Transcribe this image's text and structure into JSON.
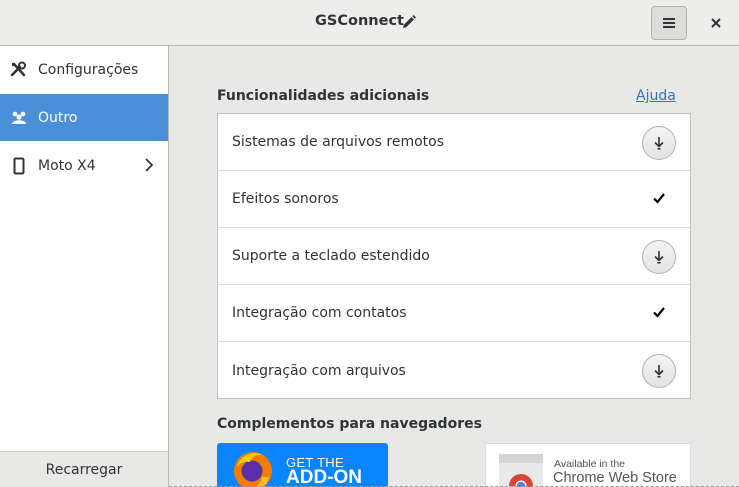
{
  "window": {
    "title": "GSConnect"
  },
  "sidebar": {
    "items": [
      {
        "label": "Configurações",
        "icon": "tools-icon"
      },
      {
        "label": "Outro",
        "icon": "people-icon",
        "selected": true
      },
      {
        "label": "Moto X4",
        "icon": "phone-icon"
      }
    ],
    "reload_label": "Recarregar"
  },
  "main": {
    "features_title": "Funcionalidades adicionais",
    "help_label": "Ajuda",
    "features": [
      {
        "label": "Sistemas de arquivos remotos",
        "state": "download"
      },
      {
        "label": "Efeitos sonoros",
        "state": "installed"
      },
      {
        "label": "Suporte a teclado estendido",
        "state": "download"
      },
      {
        "label": "Integração com contatos",
        "state": "installed"
      },
      {
        "label": "Integração com arquivos",
        "state": "download"
      }
    ],
    "browsers_title": "Complementos para navegadores",
    "firefox_badge": {
      "line1": "GET THE",
      "line2": "ADD-ON"
    },
    "chrome_badge": {
      "line1": "Available in the",
      "line2": "Chrome Web Store"
    }
  },
  "colors": {
    "accent": "#4a90d9",
    "link": "#2a76c6",
    "firefox_blue": "#0a84ff"
  }
}
